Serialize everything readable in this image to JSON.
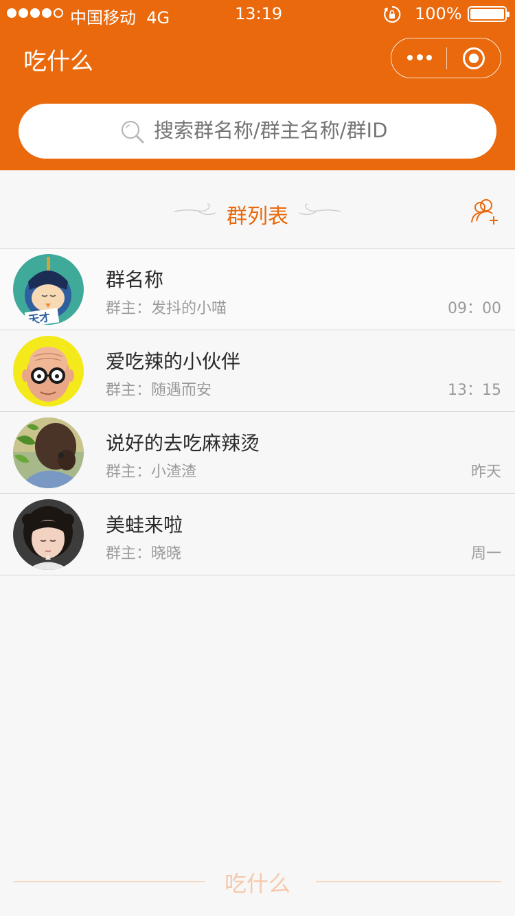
{
  "status_bar": {
    "carrier": "中国移动",
    "network": "4G",
    "time": "13:19",
    "battery": "100%"
  },
  "header": {
    "title": "吃什么",
    "more_icon": "more-dots-icon",
    "close_icon": "target-close-icon",
    "accent_color": "#e9690c"
  },
  "search": {
    "placeholder": "搜索群名称/群主名称/群ID"
  },
  "section": {
    "title": "群列表",
    "add_icon": "add-group-member-icon"
  },
  "groups": [
    {
      "name": "群名称",
      "owner": "群主：发抖的小喵",
      "time": "09：00",
      "avatar_text": "天才"
    },
    {
      "name": "爱吃辣的小伙伴",
      "owner": "群主：随遇而安",
      "time": "13：15"
    },
    {
      "name": "说好的去吃麻辣烫",
      "owner": "群主：小渣渣",
      "time": "昨天"
    },
    {
      "name": "美蛙来啦",
      "owner": "群主：晓晓",
      "time": "周一"
    }
  ],
  "footer": {
    "text": "吃什么"
  }
}
